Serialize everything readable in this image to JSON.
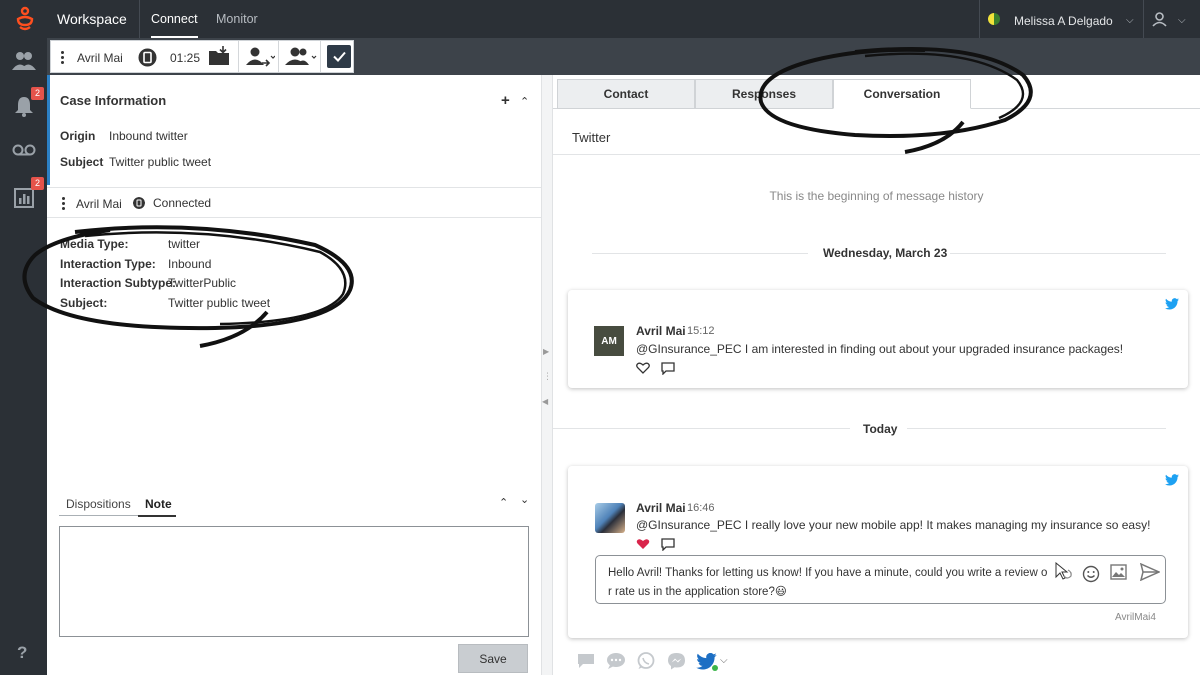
{
  "topbar": {
    "brand": "Workspace",
    "tabs": [
      {
        "label": "Connect"
      },
      {
        "label": "Monitor"
      }
    ],
    "user": {
      "name": "Melissa A Delgado"
    }
  },
  "rail": {
    "notifications_badge": "2",
    "reports_badge": "2",
    "help_label": "?"
  },
  "interaction": {
    "contact_name": "Avril Mai",
    "timer": "01:25"
  },
  "case": {
    "title": "Case Information",
    "fields": [
      {
        "label": "Origin",
        "value": "Inbound twitter"
      },
      {
        "label": "Subject",
        "value": "Twitter public tweet"
      }
    ]
  },
  "party": {
    "name": "Avril Mai",
    "status": "Connected"
  },
  "details": [
    {
      "label": "Media Type:",
      "value": "twitter"
    },
    {
      "label": "Interaction Type:",
      "value": "Inbound"
    },
    {
      "label": "Interaction Subtype:",
      "value": "TwitterPublic"
    },
    {
      "label": "Subject:",
      "value": "Twitter public tweet"
    }
  ],
  "dispositions": {
    "tabs": [
      {
        "label": "Dispositions"
      },
      {
        "label": "Note"
      }
    ],
    "active": "Note",
    "note_value": "",
    "save_label": "Save"
  },
  "right_tabs": [
    {
      "label": "Contact"
    },
    {
      "label": "Responses"
    },
    {
      "label": "Conversation"
    }
  ],
  "conversation": {
    "channel": "Twitter",
    "begin_note": "This is the beginning of message history",
    "date1": "Wednesday, March 23",
    "date2": "Today",
    "messages": [
      {
        "initials": "AM",
        "author": "Avril Mai",
        "time": "15:12",
        "text": "@GInsurance_PEC I am interested in finding out about your upgraded insurance packages!"
      },
      {
        "author": "Avril Mai",
        "time": "16:46",
        "text": "@GInsurance_PEC I really love your new mobile app! It makes managing my insurance so easy!"
      }
    ],
    "reply_line1": "Hello Avril! Thanks for letting us know! If you have a minute, could you write a review o",
    "reply_line2": "r rate us in the application store?",
    "reply_emoji": "😃",
    "handle": "AvrilMai4"
  },
  "colors": {
    "topbar": "#2b3036",
    "toolbar": "#3d434a",
    "accent_blue": "#2c80c5",
    "twitter_blue": "#1da1f2",
    "heart_red": "#d9244b",
    "badge_red": "#e5534b",
    "brand_orange": "#ff4f1f"
  }
}
